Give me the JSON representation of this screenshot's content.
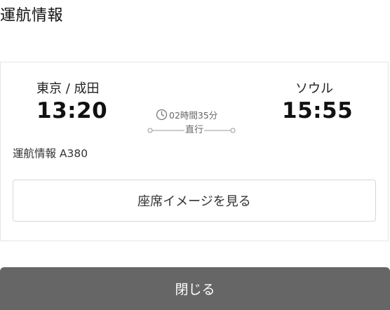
{
  "header": {
    "title": "運航情報"
  },
  "flight": {
    "origin_city": "東京 / 成田",
    "departure_time": "13:20",
    "destination_city": "ソウル",
    "arrival_time": "15:55",
    "duration": "02時間35分",
    "stops": "直行",
    "aircraft": "運航情報 A380",
    "clock_icon": "clock-icon"
  },
  "actions": {
    "seat_map_label": "座席イメージを見る",
    "close_label": "閉じる"
  },
  "colors": {
    "close_button_bg": "#666666",
    "card_border": "#e6e6e6",
    "button_border": "#d6d6d6"
  }
}
